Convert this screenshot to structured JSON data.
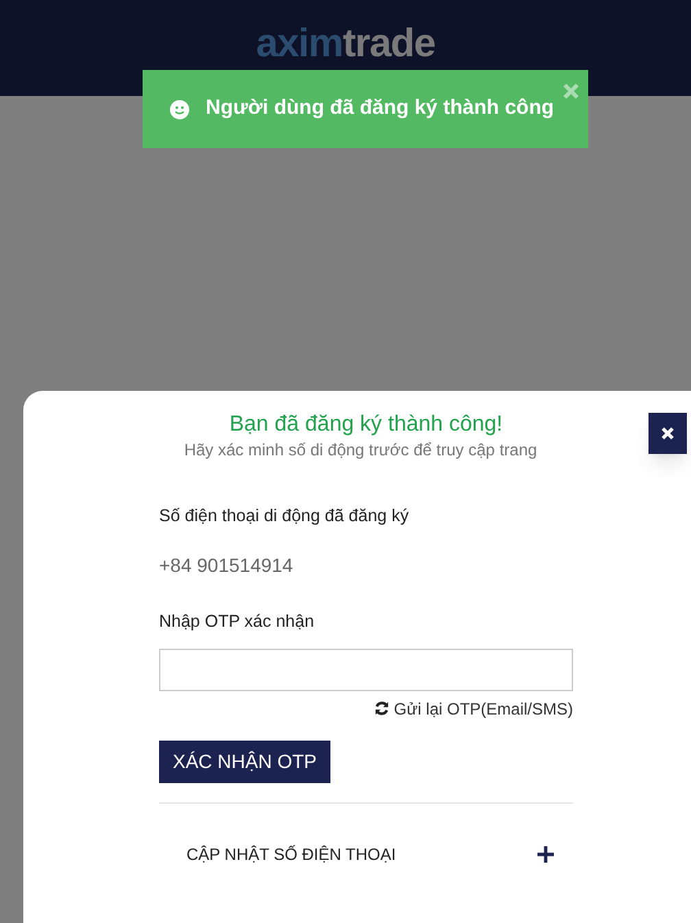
{
  "header": {
    "logo": {
      "part_1": "axim",
      "part_2": "trade"
    }
  },
  "toast": {
    "message": "Người dùng đã đăng ký thành công"
  },
  "modal": {
    "title": "Bạn đã đăng ký thành công!",
    "subtitle": "Hãy xác minh số di động trước để truy cập trang",
    "phone_label": "Số điện thoại di động đã đăng ký",
    "phone_value": "+84 901514914",
    "otp_label": "Nhập OTP xác nhận",
    "resend_link": "Gửi lại OTP(Email/SMS)",
    "confirm_button": "XÁC NHẬN OTP",
    "update_section": {
      "label": "CẬP NHẬT SỐ ĐIỆN THOẠI",
      "expanded": false
    }
  }
}
